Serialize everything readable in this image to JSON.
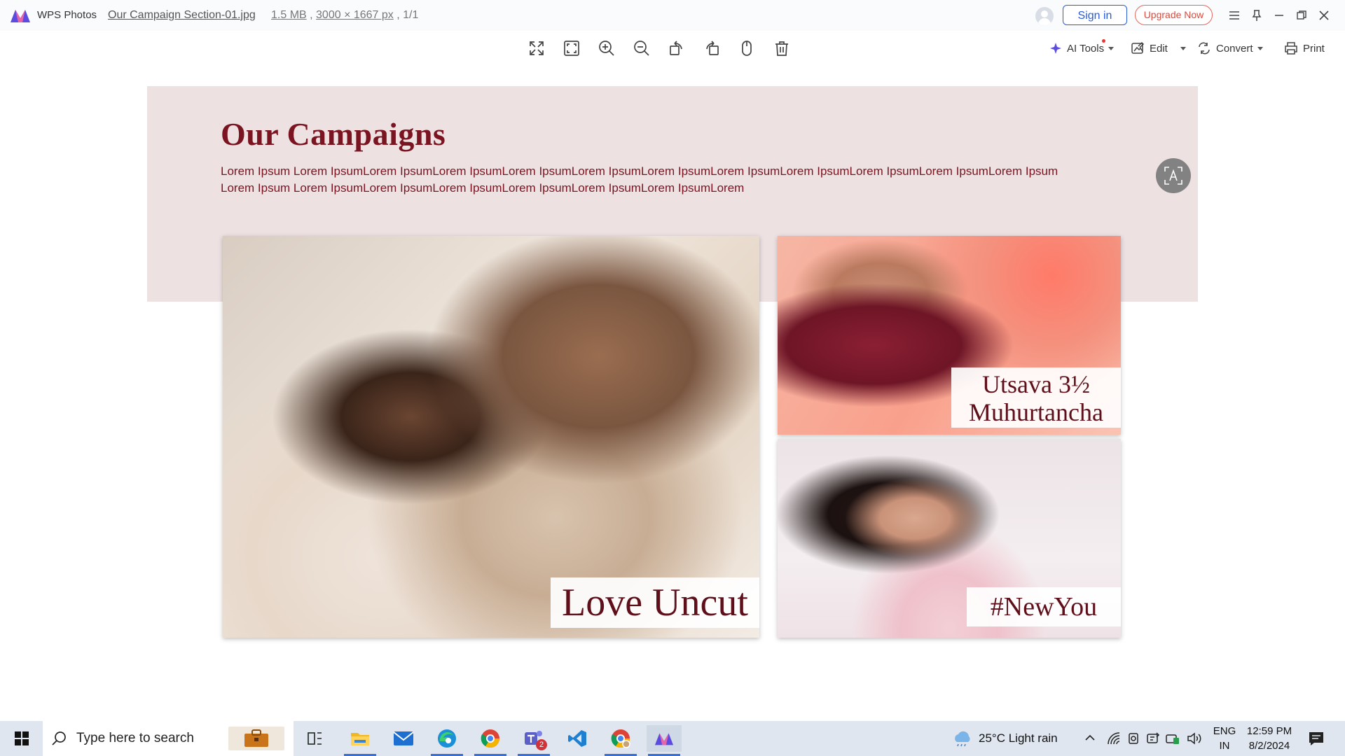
{
  "titlebar": {
    "app_name": "WPS Photos",
    "file_name": "Our Campaign Section-01.jpg",
    "file_size": "1.5 MB",
    "dimensions": "3000 × 1667 px",
    "page_count": "1/1",
    "sign_in": "Sign in",
    "upgrade": "Upgrade Now"
  },
  "toolbar": {
    "ai_tools": "AI Tools",
    "edit": "Edit",
    "convert": "Convert",
    "print": "Print"
  },
  "image": {
    "heading": "Our Campaigns",
    "paragraph": "Lorem Ipsum Lorem IpsumLorem IpsumLorem IpsumLorem IpsumLorem IpsumLorem IpsumLorem IpsumLorem IpsumLorem IpsumLorem IpsumLorem Ipsum Lorem Ipsum Lorem IpsumLorem IpsumLorem IpsumLorem IpsumLorem IpsumLorem IpsumLorem",
    "card_main_label": "Love Uncut",
    "card_tr_label_line1": "Utsava 3½",
    "card_tr_label_line2": "Muhurtancha",
    "card_br_label": "#NewYou"
  },
  "taskbar": {
    "search_placeholder": "Type here to search",
    "weather": "25°C  Light rain",
    "lang_top": "ENG",
    "lang_bottom": "IN",
    "time": "12:59 PM",
    "date": "8/2/2024",
    "teams_badge": "2"
  },
  "colors": {
    "accent_blue": "#2a5bd7",
    "upgrade_red": "#d94a3e",
    "brand_maroon": "#7a1420"
  }
}
